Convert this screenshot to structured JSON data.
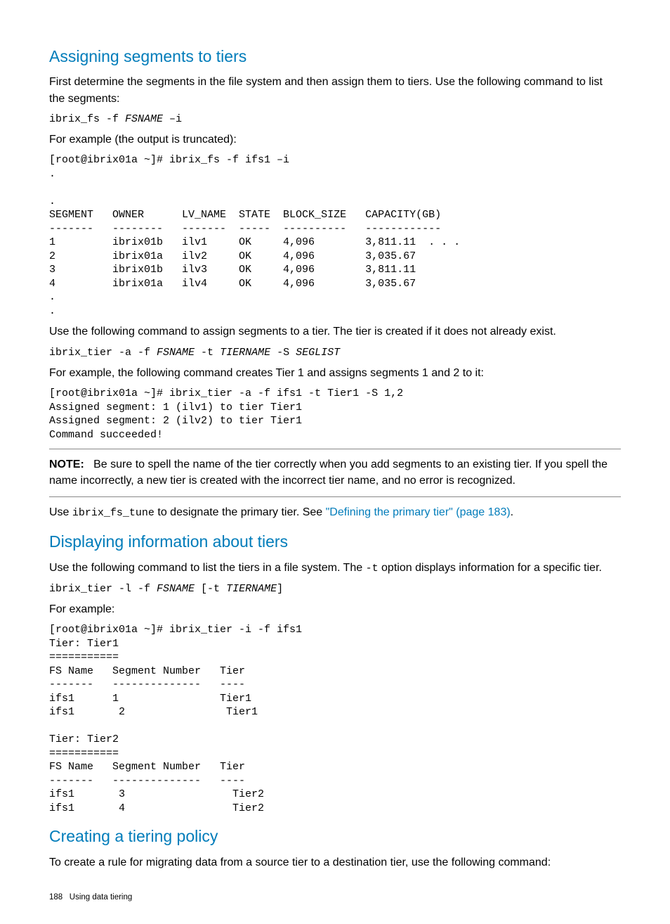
{
  "section1": {
    "heading": "Assigning segments to tiers",
    "p1": "First determine the segments in the file system and then assign them to tiers. Use the following command to list the segments:",
    "cmd1_a": "ibrix_fs -f ",
    "cmd1_b": "FSNAME",
    "cmd1_c": " –i",
    "p2": "For example (the output is truncated):",
    "output1": "[root@ibrix01a ~]# ibrix_fs -f ifs1 –i\n.\n\n.\nSEGMENT   OWNER      LV_NAME  STATE  BLOCK_SIZE   CAPACITY(GB)\n-------   --------   -------  -----  ----------   ------------\n1         ibrix01b   ilv1     OK     4,096        3,811.11  . . .\n2         ibrix01a   ilv2     OK     4,096        3,035.67\n3         ibrix01b   ilv3     OK     4,096        3,811.11\n4         ibrix01a   ilv4     OK     4,096        3,035.67\n.\n.",
    "p3": "Use the following command to assign segments to a tier. The tier is created if it does not already exist.",
    "cmd2_a": "ibrix_tier -a -f ",
    "cmd2_b": "FSNAME",
    "cmd2_c": " -t ",
    "cmd2_d": "TIERNAME",
    "cmd2_e": " -S ",
    "cmd2_f": "SEGLIST",
    "p4": "For example, the following command creates Tier 1 and assigns segments 1 and 2 to it:",
    "output2": "[root@ibrix01a ~]# ibrix_tier -a -f ifs1 -t Tier1 -S 1,2\nAssigned segment: 1 (ilv1) to tier Tier1\nAssigned segment: 2 (ilv2) to tier Tier1\nCommand succeeded!",
    "note_label": "NOTE:",
    "note_text": "Be sure to spell the name of the tier correctly when you add segments to an existing tier. If you spell the name incorrectly, a new tier is created with the incorrect tier name, and no error is recognized.",
    "p5_a": "Use ",
    "p5_b": "ibrix_fs_tune",
    "p5_c": " to designate the primary tier. See ",
    "p5_link": "\"Defining the primary tier\" (page 183)",
    "p5_d": "."
  },
  "section2": {
    "heading": "Displaying information about tiers",
    "p1_a": "Use the following command to list the tiers in a file system. The ",
    "p1_b": "-t",
    "p1_c": " option displays information for a specific tier.",
    "cmd1_a": "ibrix_tier -l -f ",
    "cmd1_b": "FSNAME",
    "cmd1_c": " [-t ",
    "cmd1_d": "TIERNAME",
    "cmd1_e": "]",
    "p2": "For example:",
    "output1": "[root@ibrix01a ~]# ibrix_tier -i -f ifs1\nTier: Tier1\n===========\nFS Name   Segment Number   Tier\n-------   --------------   ----\nifs1      1                Tier1\nifs1       2                Tier1\n\nTier: Tier2\n===========\nFS Name   Segment Number   Tier\n-------   --------------   ----\nifs1       3                 Tier2\nifs1       4                 Tier2"
  },
  "section3": {
    "heading": "Creating a tiering policy",
    "p1": "To create a rule for migrating data from a source tier to a destination tier, use the following command:"
  },
  "footer": {
    "page": "188",
    "title": "Using data tiering"
  }
}
